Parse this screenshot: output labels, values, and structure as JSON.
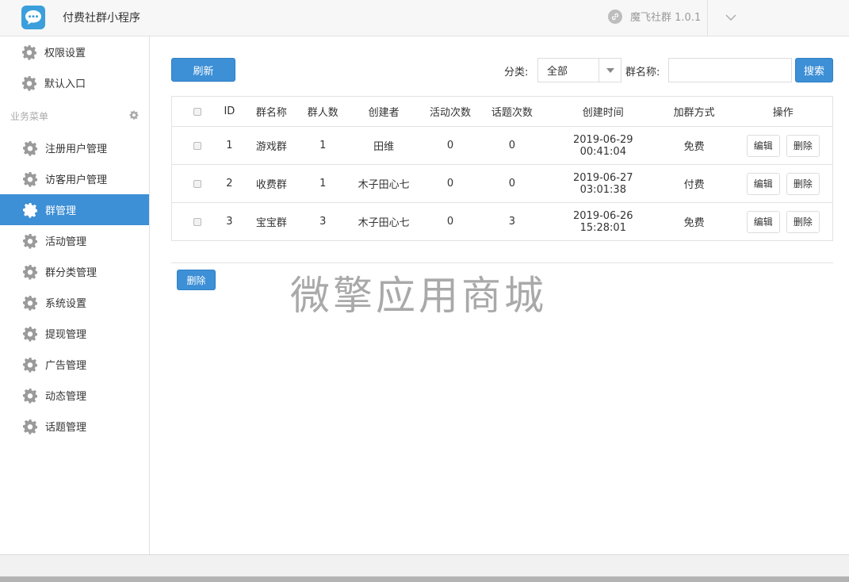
{
  "header": {
    "app_title": "付费社群小程序",
    "brand": "魔飞社群 1.0.1",
    "logo_icon": "chat-bubble-icon",
    "menu_icon": "chevron-down-icon"
  },
  "sidebar": {
    "top_items": [
      {
        "label": "权限设置",
        "icon": "gear-icon"
      },
      {
        "label": "默认入口",
        "icon": "gear-icon"
      }
    ],
    "section_title": "业务菜单",
    "items": [
      {
        "label": "注册用户管理",
        "active": false
      },
      {
        "label": "访客用户管理",
        "active": false
      },
      {
        "label": "群管理",
        "active": true
      },
      {
        "label": "活动管理",
        "active": false
      },
      {
        "label": "群分类管理",
        "active": false
      },
      {
        "label": "系统设置",
        "active": false
      },
      {
        "label": "提现管理",
        "active": false
      },
      {
        "label": "广告管理",
        "active": false
      },
      {
        "label": "动态管理",
        "active": false
      },
      {
        "label": "话题管理",
        "active": false
      }
    ]
  },
  "toolbar": {
    "refresh_label": "刷新",
    "category_label": "分类:",
    "category_value": "全部",
    "group_name_label": "群名称:",
    "group_name_value": "",
    "search_label": "搜索"
  },
  "table": {
    "headers": [
      "ID",
      "群名称",
      "群人数",
      "创建者",
      "活动次数",
      "话题次数",
      "创建时间",
      "加群方式",
      "操作"
    ],
    "edit_label": "编辑",
    "delete_label": "删除",
    "rows": [
      {
        "id": "1",
        "name": "游戏群",
        "members": "1",
        "creator": "田维",
        "activities": "0",
        "topics": "0",
        "created": "2019-06-29 00:41:04",
        "join": "免费"
      },
      {
        "id": "2",
        "name": "收费群",
        "members": "1",
        "creator": "木子田心七",
        "activities": "0",
        "topics": "0",
        "created": "2019-06-27 03:01:38",
        "join": "付费"
      },
      {
        "id": "3",
        "name": "宝宝群",
        "members": "3",
        "creator": "木子田心七",
        "activities": "0",
        "topics": "3",
        "created": "2019-06-26 15:28:01",
        "join": "免费"
      }
    ]
  },
  "bulk": {
    "delete_label": "删除"
  },
  "watermark": "微擎应用商城",
  "colors": {
    "accent": "#3d8fd6",
    "logo": "#3a9fdb"
  }
}
